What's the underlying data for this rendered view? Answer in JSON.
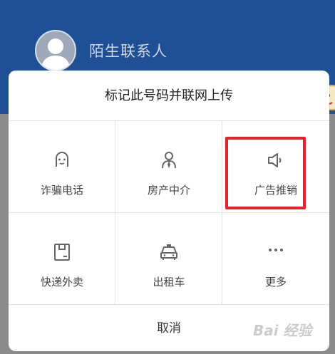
{
  "header": {
    "contact_name": "陌生联系人"
  },
  "dialog": {
    "title": "标记此号码并联网上传",
    "options": [
      {
        "label": "诈骗电话",
        "icon": "ghost-face-icon"
      },
      {
        "label": "房产中介",
        "icon": "agent-person-icon"
      },
      {
        "label": "广告推销",
        "icon": "megaphone-icon",
        "highlighted": true
      },
      {
        "label": "快递外卖",
        "icon": "package-icon"
      },
      {
        "label": "出租车",
        "icon": "taxi-icon"
      },
      {
        "label": "更多",
        "icon": "more-dots-icon"
      }
    ],
    "cancel_label": "取消"
  },
  "watermark": {
    "text": "Bai 经验"
  },
  "colors": {
    "header_bg": "#1f4f95",
    "highlight": "#e8202a",
    "overlay": "#8b8b8b"
  }
}
